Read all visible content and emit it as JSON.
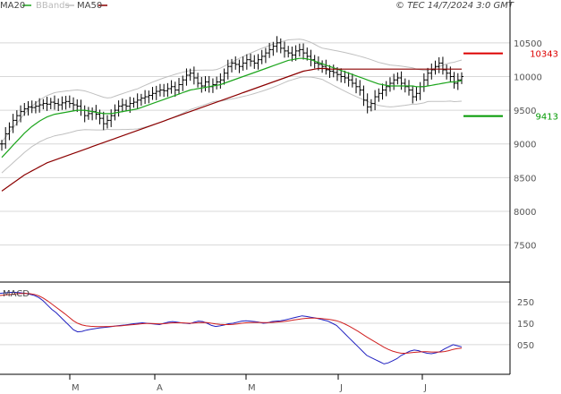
{
  "header": {
    "legend_ma20": "MA20",
    "legend_bbands": "BBands",
    "legend_ma50": "MA50",
    "copyright": "© TEC 14/7/2024 3:0 GMT"
  },
  "colors": {
    "price": "#000000",
    "ma20": "#1ca51c",
    "ma50": "#8b0000",
    "bbands": "#c0c0c0",
    "macd": "#2020c0",
    "signal": "#d02020",
    "resistance": "#dd0000",
    "support": "#009900",
    "grid": "#d8d8d8"
  },
  "chart_data": [
    {
      "type": "line",
      "subtype": "ohlc-price",
      "title": "",
      "x_tick_labels": [
        "M",
        "A",
        "M",
        "J",
        "J"
      ],
      "y_tick_labels": [
        "10500",
        "10000",
        "9500",
        "9000",
        "8500",
        "8000",
        "7500"
      ],
      "y_ticks": [
        10500,
        10000,
        9500,
        9000,
        8500,
        8000,
        7500
      ],
      "ylim": [
        6950,
        10950
      ],
      "grid": true,
      "close": [
        9000,
        9150,
        9250,
        9350,
        9420,
        9480,
        9520,
        9550,
        9540,
        9560,
        9580,
        9600,
        9590,
        9620,
        9600,
        9580,
        9610,
        9630,
        9600,
        9580,
        9560,
        9500,
        9420,
        9450,
        9480,
        9440,
        9380,
        9300,
        9350,
        9420,
        9500,
        9560,
        9580,
        9560,
        9600,
        9620,
        9650,
        9680,
        9700,
        9720,
        9750,
        9780,
        9800,
        9790,
        9820,
        9850,
        9800,
        9880,
        9950,
        10020,
        10050,
        9980,
        9900,
        9860,
        9920,
        9850,
        9880,
        9920,
        9950,
        10050,
        10150,
        10200,
        10180,
        10150,
        10200,
        10250,
        10230,
        10200,
        10250,
        10300,
        10350,
        10400,
        10450,
        10500,
        10420,
        10380,
        10350,
        10320,
        10380,
        10400,
        10350,
        10300,
        10250,
        10200,
        10180,
        10150,
        10100,
        10080,
        10060,
        10030,
        10000,
        9980,
        9950,
        9900,
        9850,
        9800,
        9650,
        9550,
        9600,
        9700,
        9750,
        9800,
        9850,
        9900,
        9950,
        9980,
        9900,
        9850,
        9800,
        9700,
        9750,
        9850,
        9950,
        10050,
        10100,
        10150,
        10200,
        10100,
        10050,
        10000,
        9900,
        9950,
        10000
      ],
      "series": [
        {
          "name": "MA20",
          "values": [
            8800,
            8860,
            8920,
            8980,
            9040,
            9100,
            9160,
            9210,
            9260,
            9300,
            9340,
            9370,
            9400,
            9420,
            9440,
            9450,
            9460,
            9470,
            9480,
            9490,
            9500,
            9500,
            9500,
            9490,
            9480,
            9470,
            9460,
            9450,
            9450,
            9450,
            9460,
            9470,
            9480,
            9490,
            9500,
            9510,
            9520,
            9540,
            9560,
            9580,
            9600,
            9620,
            9640,
            9660,
            9680,
            9700,
            9720,
            9740,
            9760,
            9780,
            9800,
            9810,
            9820,
            9830,
            9840,
            9850,
            9860,
            9870,
            9880,
            9900,
            9920,
            9940,
            9960,
            9980,
            10000,
            10020,
            10040,
            10060,
            10080,
            10100,
            10120,
            10140,
            10160,
            10180,
            10200,
            10220,
            10240,
            10250,
            10260,
            10270,
            10270,
            10260,
            10250,
            10230,
            10210,
            10190,
            10170,
            10150,
            10130,
            10110,
            10090,
            10070,
            10050,
            10030,
            10010,
            9990,
            9970,
            9950,
            9930,
            9910,
            9890,
            9880,
            9870,
            9860,
            9860,
            9860,
            9860,
            9860,
            9860,
            9860,
            9850,
            9850,
            9850,
            9860,
            9870,
            9880,
            9890,
            9900,
            9910,
            9920,
            9920,
            9930,
            9940
          ]
        },
        {
          "name": "MA50",
          "values": [
            8300,
            8340,
            8380,
            8420,
            8460,
            8500,
            8540,
            8570,
            8600,
            8630,
            8660,
            8690,
            8720,
            8740,
            8760,
            8780,
            8800,
            8820,
            8840,
            8860,
            8880,
            8900,
            8920,
            8940,
            8960,
            8980,
            9000,
            9020,
            9040,
            9060,
            9080,
            9100,
            9120,
            9140,
            9160,
            9180,
            9200,
            9220,
            9240,
            9260,
            9280,
            9300,
            9320,
            9340,
            9360,
            9380,
            9400,
            9420,
            9440,
            9460,
            9480,
            9500,
            9520,
            9540,
            9560,
            9580,
            9600,
            9620,
            9640,
            9660,
            9680,
            9700,
            9720,
            9740,
            9760,
            9780,
            9800,
            9820,
            9840,
            9860,
            9880,
            9900,
            9920,
            9940,
            9960,
            9980,
            10000,
            10020,
            10040,
            10060,
            10080,
            10090,
            10100,
            10110,
            10120,
            10120,
            10120,
            10110,
            10110,
            10110,
            10110,
            10110,
            10110,
            10110,
            10110,
            10110,
            10110,
            10110,
            10110,
            10110,
            10110,
            10110,
            10110,
            10110,
            10110,
            10110,
            10110,
            10110,
            10110,
            10110,
            10110,
            10110,
            10110,
            10110,
            10110,
            10110,
            10110,
            10110,
            10110,
            10110,
            10110,
            10110,
            10110
          ]
        }
      ],
      "levels": [
        {
          "label": "10343",
          "value": 10343,
          "kind": "resistance"
        },
        {
          "label": "9413",
          "value": 9413,
          "kind": "support"
        }
      ]
    },
    {
      "type": "line",
      "title": "MACD",
      "y_tick_labels": [
        "250",
        "150",
        "050"
      ],
      "y_ticks": [
        250,
        150,
        50
      ],
      "ylim": [
        -80,
        330
      ],
      "grid": true,
      "series": [
        {
          "name": "",
          "values": [
            290,
            292,
            294,
            295,
            294,
            292,
            290,
            285,
            280,
            270,
            255,
            235,
            215,
            200,
            180,
            160,
            140,
            120,
            110,
            112,
            118,
            122,
            125,
            128,
            130,
            132,
            135,
            138,
            140,
            142,
            145,
            148,
            150,
            152,
            150,
            148,
            146,
            144,
            150,
            155,
            158,
            155,
            152,
            150,
            148,
            155,
            160,
            158,
            150,
            140,
            135,
            138,
            142,
            148,
            150,
            155,
            160,
            162,
            160,
            158,
            155,
            150,
            152,
            158,
            160,
            162,
            165,
            170,
            175,
            180,
            185,
            182,
            178,
            175,
            170,
            165,
            160,
            150,
            140,
            120,
            100,
            80,
            60,
            40,
            20,
            0,
            -10,
            -20,
            -30,
            -40,
            -35,
            -25,
            -15,
            0,
            10,
            20,
            25,
            22,
            15,
            10,
            8,
            12,
            18,
            30,
            40,
            50,
            45,
            40
          ]
        },
        {
          "name": "",
          "values": [
            280,
            282,
            284,
            286,
            288,
            289,
            290,
            288,
            285,
            278,
            268,
            255,
            240,
            225,
            210,
            195,
            178,
            162,
            150,
            142,
            138,
            136,
            135,
            134,
            134,
            135,
            136,
            137,
            138,
            140,
            142,
            144,
            146,
            148,
            149,
            149,
            148,
            147,
            148,
            150,
            152,
            152,
            152,
            151,
            150,
            151,
            153,
            154,
            153,
            150,
            147,
            145,
            144,
            144,
            145,
            147,
            150,
            152,
            153,
            154,
            154,
            153,
            153,
            154,
            155,
            157,
            159,
            162,
            165,
            168,
            171,
            173,
            174,
            174,
            173,
            171,
            169,
            166,
            162,
            155,
            146,
            136,
            124,
            112,
            99,
            86,
            74,
            62,
            50,
            38,
            28,
            20,
            14,
            10,
            10,
            12,
            14,
            16,
            17,
            17,
            16,
            16,
            16,
            18,
            22,
            28,
            32,
            34
          ]
        }
      ]
    }
  ]
}
